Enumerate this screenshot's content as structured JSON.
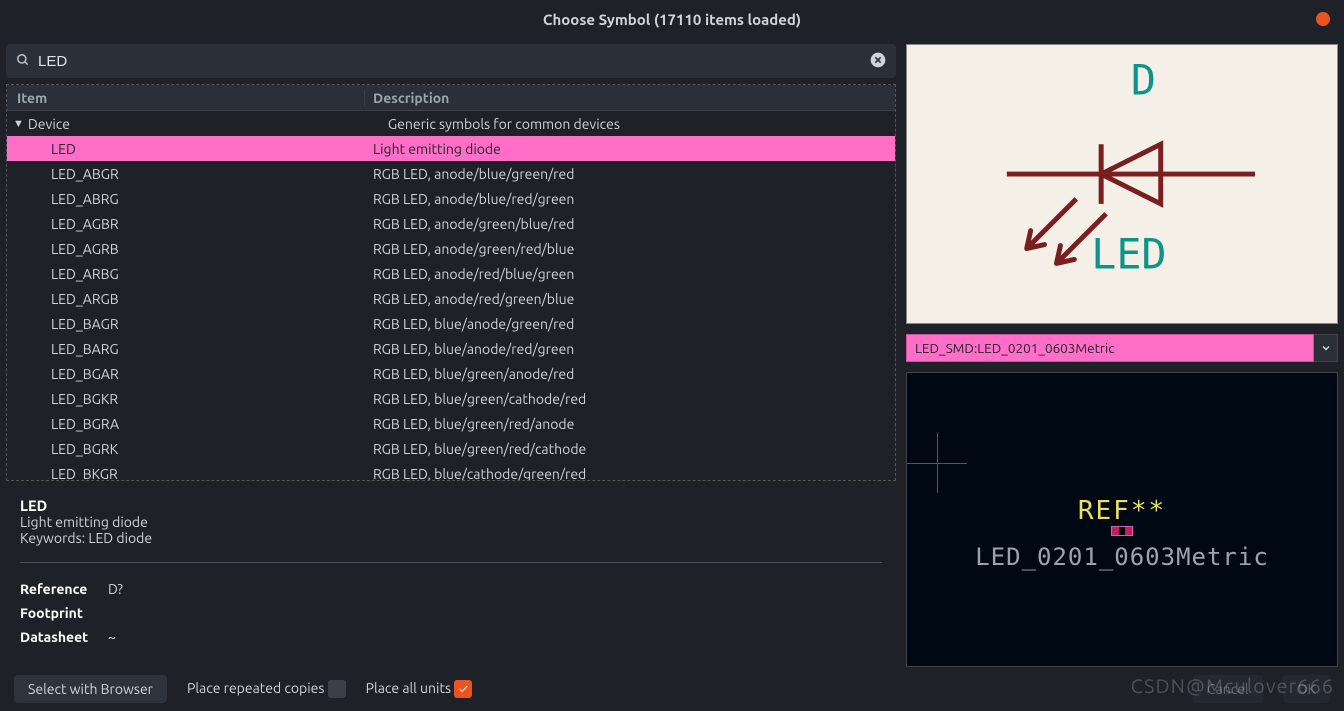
{
  "window": {
    "title": "Choose Symbol (17110 items loaded)"
  },
  "search": {
    "value": "LED",
    "placeholder": ""
  },
  "columns": {
    "item": "Item",
    "desc": "Description"
  },
  "category": {
    "name": "Device",
    "desc": "Generic symbols for common devices"
  },
  "rows": [
    {
      "name": "LED",
      "desc": "Light emitting diode",
      "selected": true
    },
    {
      "name": "LED_ABGR",
      "desc": "RGB LED, anode/blue/green/red"
    },
    {
      "name": "LED_ABRG",
      "desc": "RGB LED, anode/blue/red/green"
    },
    {
      "name": "LED_AGBR",
      "desc": "RGB LED, anode/green/blue/red"
    },
    {
      "name": "LED_AGRB",
      "desc": "RGB LED, anode/green/red/blue"
    },
    {
      "name": "LED_ARBG",
      "desc": "RGB LED, anode/red/blue/green"
    },
    {
      "name": "LED_ARGB",
      "desc": "RGB LED, anode/red/green/blue"
    },
    {
      "name": "LED_BAGR",
      "desc": "RGB LED, blue/anode/green/red"
    },
    {
      "name": "LED_BARG",
      "desc": "RGB LED, blue/anode/red/green"
    },
    {
      "name": "LED_BGAR",
      "desc": "RGB LED, blue/green/anode/red"
    },
    {
      "name": "LED_BGKR",
      "desc": "RGB LED, blue/green/cathode/red"
    },
    {
      "name": "LED_BGRA",
      "desc": "RGB LED, blue/green/red/anode"
    },
    {
      "name": "LED_BGRK",
      "desc": "RGB LED, blue/green/red/cathode"
    },
    {
      "name": "LED_BKGR",
      "desc": "RGB LED, blue/cathode/green/red"
    }
  ],
  "details": {
    "title": "LED",
    "subtitle": "Light emitting diode",
    "keywords_label": "Keywords:",
    "keywords": "LED diode",
    "reference_label": "Reference",
    "reference": "D?",
    "footprint_label": "Footprint",
    "footprint": "",
    "datasheet_label": "Datasheet",
    "datasheet": "~"
  },
  "preview_symbol": {
    "ref": "D",
    "label": "LED"
  },
  "footprint_select": {
    "value": "LED_SMD:LED_0201_0603Metric"
  },
  "footprint_preview": {
    "ref": "REF**",
    "name": "LED_0201_0603Metric"
  },
  "footer": {
    "select_browser": "Select with Browser",
    "repeated": "Place repeated copies",
    "all_units": "Place all units",
    "cancel": "Cancel",
    "ok": "OK"
  },
  "watermark": "CSDN@Mculover666"
}
